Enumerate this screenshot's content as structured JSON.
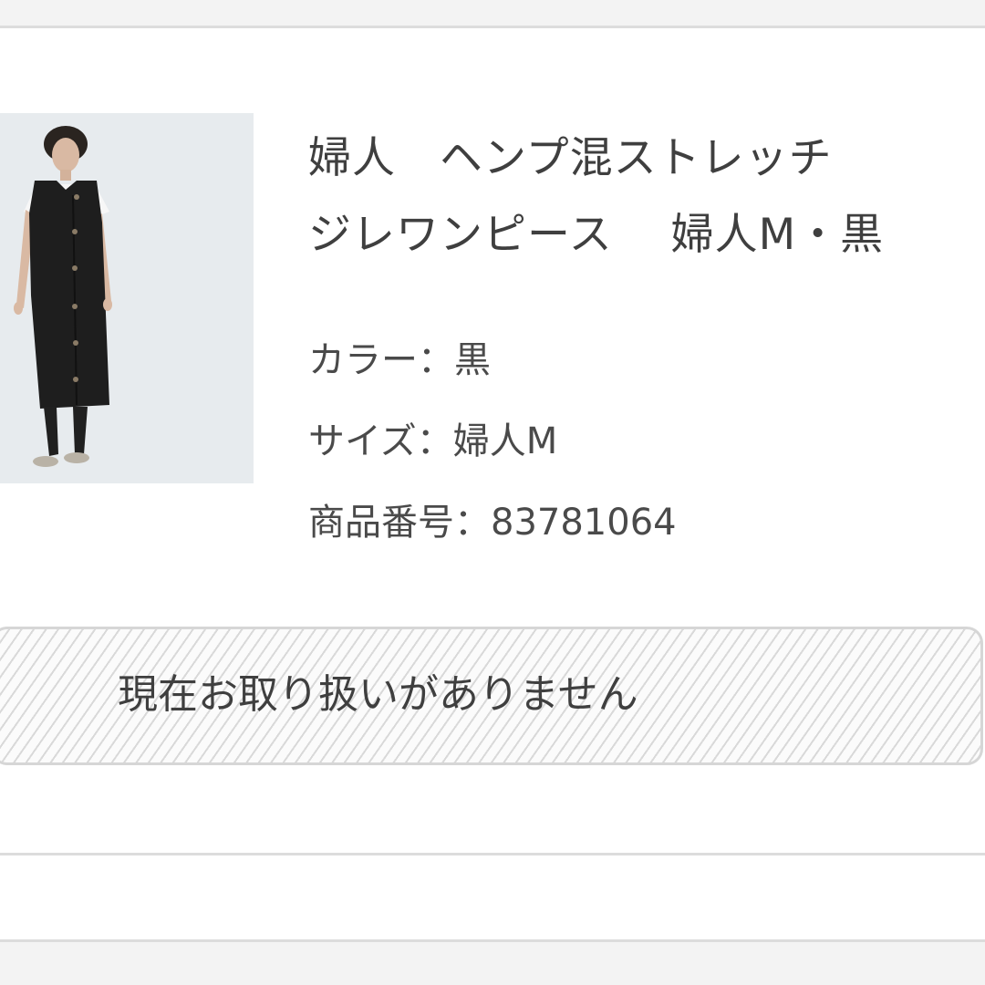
{
  "product": {
    "title": "婦人　ヘンプ混ストレッチ\nジレワンピース　 婦人M・黒",
    "image_icon": "product-photo-icon",
    "specs": {
      "color": "カラー：黒",
      "size": "サイズ：婦人M",
      "number": "商品番号：83781064"
    }
  },
  "status": {
    "label": "現在お取り扱いがありません"
  },
  "colors": {
    "background": "#f2f2f2",
    "card": "#ffffff",
    "text": "#4a4a4a",
    "stripe": "#d9d9d9"
  }
}
